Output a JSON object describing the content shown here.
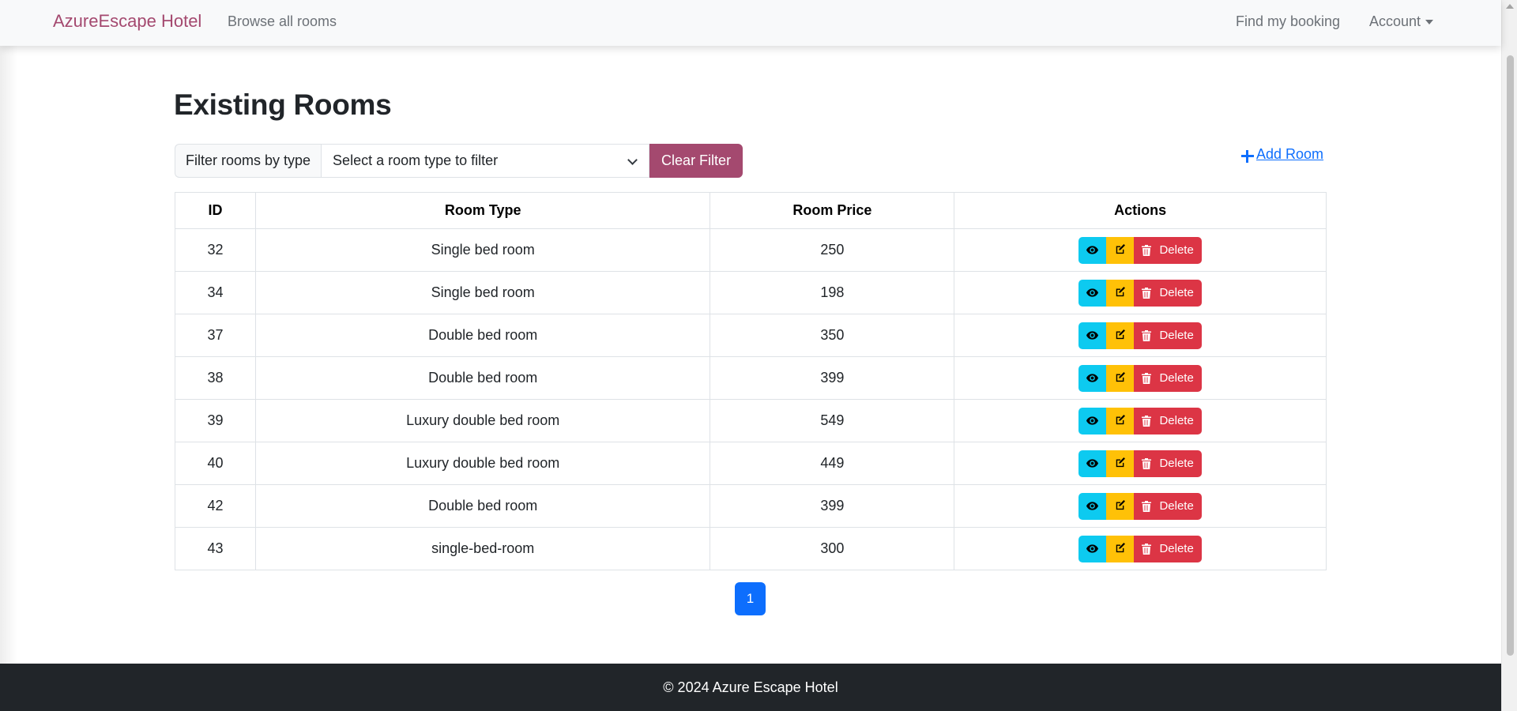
{
  "navbar": {
    "brand": "AzureEscape Hotel",
    "browse_link": "Browse all rooms",
    "find_booking_link": "Find my booking",
    "account_menu": "Account"
  },
  "main": {
    "title": "Existing Rooms",
    "filter": {
      "label": "Filter rooms by type",
      "select_value": "Select a room type to filter",
      "clear_button": "Clear Filter"
    },
    "add_room_link": "Add Room",
    "table": {
      "headers": [
        "ID",
        "Room Type",
        "Room Price",
        "Actions"
      ],
      "rows": [
        {
          "id": "32",
          "type": "Single bed room",
          "price": "250"
        },
        {
          "id": "34",
          "type": "Single bed room",
          "price": "198"
        },
        {
          "id": "37",
          "type": "Double bed room",
          "price": "350"
        },
        {
          "id": "38",
          "type": "Double bed room",
          "price": "399"
        },
        {
          "id": "39",
          "type": "Luxury double bed room",
          "price": "549"
        },
        {
          "id": "40",
          "type": "Luxury double bed room",
          "price": "449"
        },
        {
          "id": "42",
          "type": "Double bed room",
          "price": "399"
        },
        {
          "id": "43",
          "type": "single-bed-room",
          "price": "300"
        }
      ],
      "delete_label": "Delete"
    },
    "pagination": {
      "current_page": "1"
    }
  },
  "footer": {
    "text": "© 2024 Azure Escape Hotel"
  },
  "colors": {
    "brand": "#a4496f",
    "view_button": "#0dcaf0",
    "edit_button": "#ffc107",
    "delete_button": "#dc3545",
    "link": "#0d6efd",
    "footer_bg": "#212529"
  },
  "icons": {
    "view": "eye-icon",
    "edit": "edit-icon",
    "delete": "trash-icon",
    "add": "plus-icon",
    "account_caret": "caret-down-icon",
    "select_chevron": "chevron-down-icon"
  }
}
